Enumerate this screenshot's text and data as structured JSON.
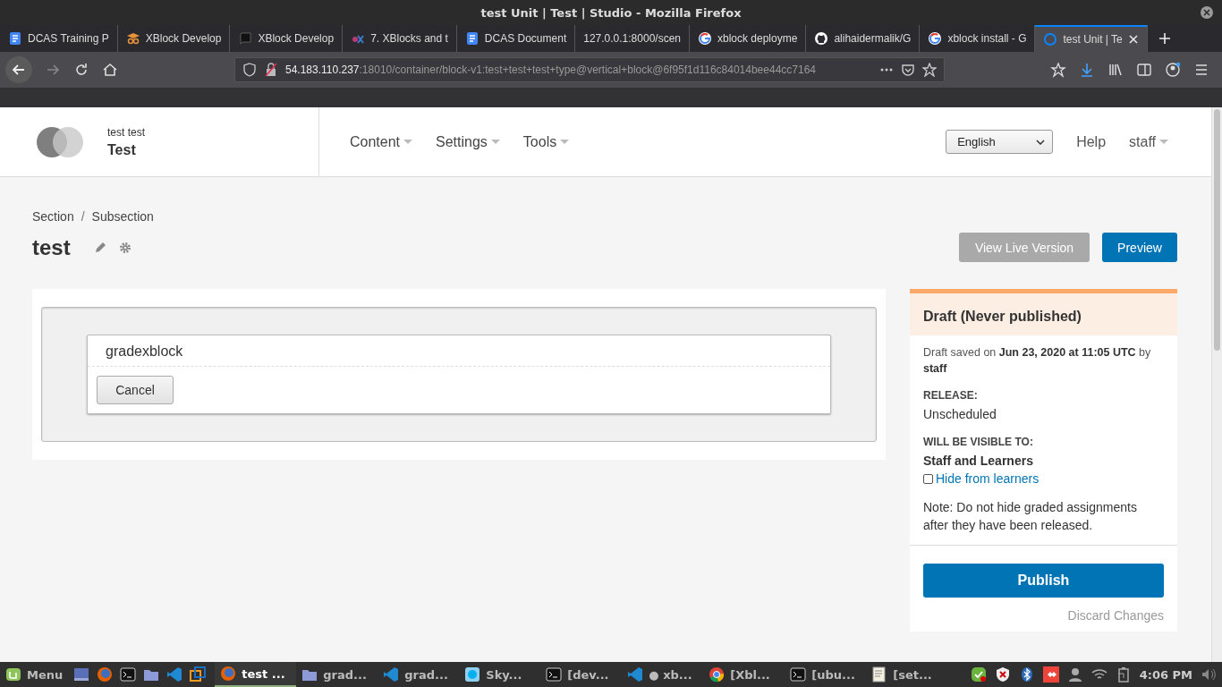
{
  "window": {
    "title": "test Unit | Test | Studio - Mozilla Firefox"
  },
  "tabs": [
    {
      "kind": "doc",
      "label": "DCAS Training P",
      "selected": false
    },
    {
      "kind": "grad",
      "label": "XBlock Develop",
      "selected": false
    },
    {
      "kind": "book",
      "label": "XBlock Develop",
      "selected": false
    },
    {
      "kind": "edx",
      "label": "7. XBlocks and t",
      "selected": false
    },
    {
      "kind": "doc",
      "label": "DCAS Document",
      "selected": false
    },
    {
      "kind": "none",
      "label": "127.0.0.1:8000/scen",
      "selected": false
    },
    {
      "kind": "google",
      "label": "xblock deployme",
      "selected": false
    },
    {
      "kind": "github",
      "label": "alihaidermalik/G",
      "selected": false
    },
    {
      "kind": "google",
      "label": "xblock install - G",
      "selected": false
    },
    {
      "kind": "ring",
      "label": "test Unit | Te",
      "selected": true
    }
  ],
  "address": {
    "host": "54.183.110.237",
    "path": ":18010/container/block-v1:test+test+test+type@vertical+block@6f95f1d116c84014bee44cc7164"
  },
  "header": {
    "org": "test test",
    "course": "Test",
    "nav": [
      "Content",
      "Settings",
      "Tools"
    ],
    "language": "English",
    "help": "Help",
    "user": "staff"
  },
  "breadcrumbs": [
    "Section",
    "Subsection"
  ],
  "breadcrumb_separator": "/",
  "unit_title": "test",
  "actions": [
    {
      "label": "View Live Version",
      "disabled": true
    },
    {
      "label": "Preview",
      "disabled": false
    }
  ],
  "xblock": {
    "name": "gradexblock",
    "cancel": "Cancel"
  },
  "status": {
    "title": "Draft (Never published)",
    "saved_prefix": "Draft saved on",
    "saved_date": "Jun 23, 2020 at 11:05 UTC",
    "saved_by": "by",
    "saved_user": "staff",
    "release_label": "RELEASE:",
    "release_value": "Unscheduled",
    "visible_label": "WILL BE VISIBLE TO:",
    "visible_value": "Staff and Learners",
    "hide_label": "Hide from learners",
    "hide_checked": false,
    "note": "Note: Do not hide graded assignments after they have been released.",
    "publish": "Publish",
    "discard": "Discard Changes"
  },
  "taskbar": {
    "menu": "Menu",
    "windows": [
      {
        "kind": "firefox",
        "label": "test ...",
        "selected": true
      },
      {
        "kind": "folder",
        "label": "grad...",
        "selected": false
      },
      {
        "kind": "vscode",
        "label": "grad...",
        "selected": false
      },
      {
        "kind": "skype",
        "label": "Sky...",
        "selected": false
      },
      {
        "kind": "terminal",
        "label": "[dev...",
        "selected": false
      },
      {
        "kind": "vscode",
        "label": "● xb...",
        "selected": false
      },
      {
        "kind": "chrome",
        "label": "[Xbl...",
        "selected": false
      },
      {
        "kind": "terminal",
        "label": "[ubu...",
        "selected": false
      },
      {
        "kind": "editor",
        "label": "[set...",
        "selected": false
      }
    ],
    "clock": "4:06 PM"
  }
}
